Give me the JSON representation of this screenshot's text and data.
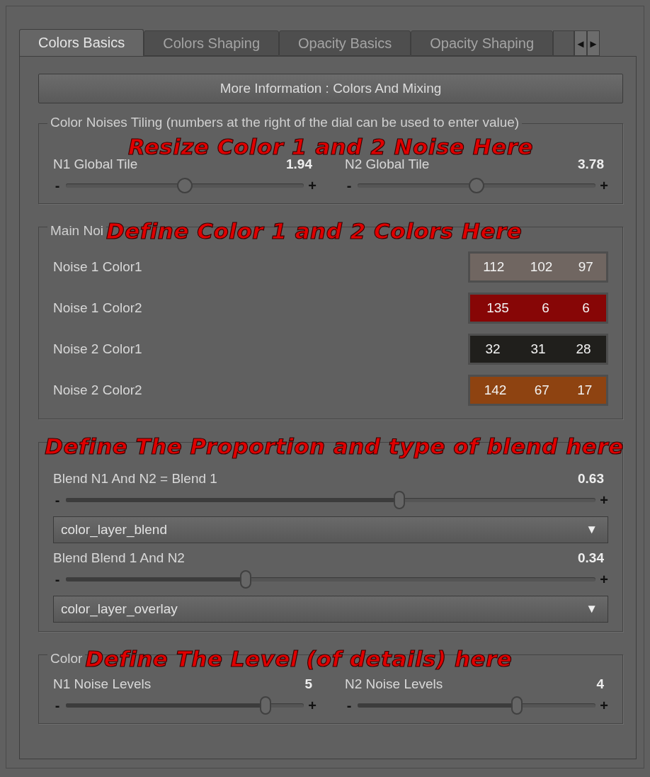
{
  "tabs": [
    {
      "label": "Colors Basics",
      "selected": true
    },
    {
      "label": "Colors Shaping",
      "selected": false
    },
    {
      "label": "Opacity Basics",
      "selected": false
    },
    {
      "label": "Opacity Shaping",
      "selected": false
    }
  ],
  "tab_scroll": {
    "prev": "◄",
    "next": "►"
  },
  "info_button": "More Information : Colors And Mixing",
  "groups": [
    {
      "title": "Color Noises Tiling (numbers at the right of the dial can be used to enter value)",
      "annotation": "Resize Color 1 and 2 Noise Here",
      "annotation_below": true,
      "kind": "sliders",
      "sliders": [
        {
          "label": "N1 Global Tile",
          "reading": "1.94",
          "level": 0.5,
          "filled": false,
          "minus": "-",
          "plus": "+"
        },
        {
          "label": "N2 Global Tile",
          "reading": "3.78",
          "level": 0.5,
          "filled": false,
          "minus": "-",
          "plus": "+"
        }
      ]
    },
    {
      "title": "Main Noi",
      "annotation": "Define Color 1 and 2 Colors Here",
      "annotation_below": false,
      "kind": "colors",
      "colors": [
        {
          "label": "Noise 1 Color1",
          "color": "#706661",
          "values": [
            "112",
            "102",
            "97"
          ]
        },
        {
          "label": "Noise 1 Color2",
          "color": "#870606",
          "values": [
            "135",
            "6",
            "6"
          ]
        },
        {
          "label": "Noise 2 Color1",
          "color": "#201f1c",
          "values": [
            "32",
            "31",
            "28"
          ]
        },
        {
          "label": "Noise 2 Color2",
          "color": "#8e4311",
          "values": [
            "142",
            "67",
            "17"
          ]
        }
      ]
    },
    {
      "annotation": "Define The Proportion and type of blend here",
      "annotation_below": false,
      "kind": "blend",
      "items": [
        {
          "kind": "slider",
          "label": "Blend N1 And N2 = Blend 1",
          "reading": "0.63",
          "level": 0.63,
          "filled": true,
          "minus": "-",
          "plus": "+"
        },
        {
          "kind": "dropdown",
          "value": "color_layer_blend",
          "arrow": "▼"
        },
        {
          "kind": "slider",
          "label": "Blend Blend 1 And N2",
          "reading": "0.34",
          "level": 0.34,
          "filled": true,
          "minus": "-",
          "plus": "+"
        },
        {
          "kind": "dropdown",
          "value": "color_layer_overlay",
          "arrow": "▼"
        }
      ]
    },
    {
      "title": "Color",
      "annotation": "Define The Level (of details) here",
      "annotation_below": false,
      "kind": "sliders",
      "sliders": [
        {
          "label": "N1 Noise Levels",
          "reading": "5",
          "level": 0.84,
          "filled": true,
          "minus": "-",
          "plus": "+"
        },
        {
          "label": "N2 Noise Levels",
          "reading": "4",
          "level": 0.67,
          "filled": true,
          "minus": "-",
          "plus": "+"
        }
      ]
    }
  ]
}
